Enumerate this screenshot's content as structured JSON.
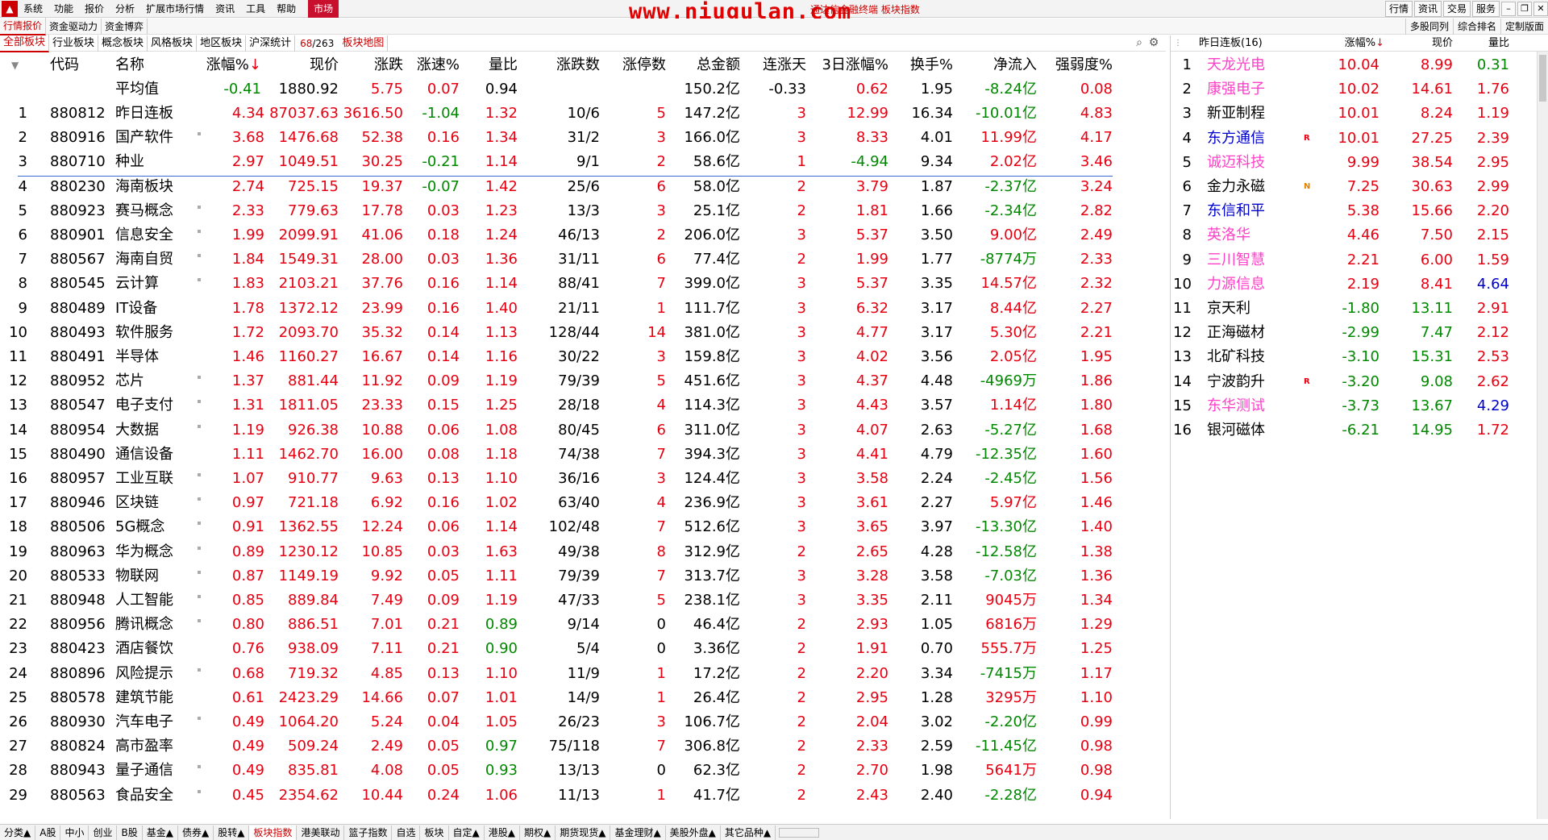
{
  "menubar": {
    "items": [
      "系统",
      "功能",
      "报价",
      "分析",
      "扩展市场行情",
      "资讯",
      "工具",
      "帮助"
    ],
    "active": "市场",
    "brand": "www.niugulan.com",
    "title": "通达信金融终端  板块指数",
    "right_buttons": [
      "行情",
      "资讯",
      "交易",
      "服务"
    ]
  },
  "tabbar1": {
    "tabs": [
      "行情报价",
      "资金驱动力",
      "资金博弈"
    ],
    "right_tabs": [
      "多股同列",
      "综合排名",
      "定制版面"
    ]
  },
  "tabbar2": {
    "tabs": [
      "全部板块",
      "行业板块",
      "概念板块",
      "风格板块",
      "地区板块",
      "沪深统计"
    ],
    "counter_current": "68",
    "counter_total": "/263",
    "map_tab": "板块地图"
  },
  "left_headers": {
    "code": "代码",
    "name": "名称",
    "pct": "涨幅%",
    "price": "现价",
    "chg": "涨跌",
    "speed": "涨速%",
    "vr": "量比",
    "updown": "涨跌数",
    "limitup": "涨停数",
    "amount": "总金额",
    "days": "连涨天",
    "d3": "3日涨幅%",
    "turnover": "换手%",
    "inflow": "净流入",
    "strength": "强弱度%"
  },
  "avg_row": {
    "name": "平均值",
    "pct": "-0.41",
    "price": "1880.92",
    "chg": "5.75",
    "speed": "0.07",
    "vr": "0.94",
    "amount": "150.2亿",
    "days": "-0.33",
    "d3": "0.62",
    "turnover": "1.95",
    "inflow": "-8.24亿",
    "strength": "0.08"
  },
  "rows": [
    {
      "no": "1",
      "code": "880812",
      "name": "昨日连板",
      "pct": "4.34",
      "price": "87037.63",
      "chg": "3616.50",
      "speed": "-1.04",
      "vr": "1.32",
      "updown": "10/6",
      "limitup": "5",
      "amount": "147.2亿",
      "days": "3",
      "d3": "12.99",
      "turnover": "16.34",
      "inflow": "-10.01亿",
      "strength": "4.83",
      "mark": false
    },
    {
      "no": "2",
      "code": "880916",
      "name": "国产软件",
      "pct": "3.68",
      "price": "1476.68",
      "chg": "52.38",
      "speed": "0.16",
      "vr": "1.34",
      "updown": "31/2",
      "limitup": "3",
      "amount": "166.0亿",
      "days": "3",
      "d3": "8.33",
      "turnover": "4.01",
      "inflow": "11.99亿",
      "strength": "4.17",
      "mark": true
    },
    {
      "no": "3",
      "code": "880710",
      "name": "种业",
      "pct": "2.97",
      "price": "1049.51",
      "chg": "30.25",
      "speed": "-0.21",
      "vr": "1.14",
      "updown": "9/1",
      "limitup": "2",
      "amount": "58.6亿",
      "days": "1",
      "d3": "-4.94",
      "turnover": "9.34",
      "inflow": "2.02亿",
      "strength": "3.46",
      "mark": false
    },
    {
      "no": "4",
      "code": "880230",
      "name": "海南板块",
      "pct": "2.74",
      "price": "725.15",
      "chg": "19.37",
      "speed": "-0.07",
      "vr": "1.42",
      "updown": "25/6",
      "limitup": "6",
      "amount": "58.0亿",
      "days": "2",
      "d3": "3.79",
      "turnover": "1.87",
      "inflow": "-2.37亿",
      "strength": "3.24",
      "mark": false
    },
    {
      "no": "5",
      "code": "880923",
      "name": "赛马概念",
      "pct": "2.33",
      "price": "779.63",
      "chg": "17.78",
      "speed": "0.03",
      "vr": "1.23",
      "updown": "13/3",
      "limitup": "3",
      "amount": "25.1亿",
      "days": "2",
      "d3": "1.81",
      "turnover": "1.66",
      "inflow": "-2.34亿",
      "strength": "2.82",
      "mark": true
    },
    {
      "no": "6",
      "code": "880901",
      "name": "信息安全",
      "pct": "1.99",
      "price": "2099.91",
      "chg": "41.06",
      "speed": "0.18",
      "vr": "1.24",
      "updown": "46/13",
      "limitup": "2",
      "amount": "206.0亿",
      "days": "3",
      "d3": "5.37",
      "turnover": "3.50",
      "inflow": "9.00亿",
      "strength": "2.49",
      "mark": true
    },
    {
      "no": "7",
      "code": "880567",
      "name": "海南自贸",
      "pct": "1.84",
      "price": "1549.31",
      "chg": "28.00",
      "speed": "0.03",
      "vr": "1.36",
      "updown": "31/11",
      "limitup": "6",
      "amount": "77.4亿",
      "days": "2",
      "d3": "1.99",
      "turnover": "1.77",
      "inflow": "-8774万",
      "strength": "2.33",
      "mark": true
    },
    {
      "no": "8",
      "code": "880545",
      "name": "云计算",
      "pct": "1.83",
      "price": "2103.21",
      "chg": "37.76",
      "speed": "0.16",
      "vr": "1.14",
      "updown": "88/41",
      "limitup": "7",
      "amount": "399.0亿",
      "days": "3",
      "d3": "5.37",
      "turnover": "3.35",
      "inflow": "14.57亿",
      "strength": "2.32",
      "mark": true
    },
    {
      "no": "9",
      "code": "880489",
      "name": "IT设备",
      "pct": "1.78",
      "price": "1372.12",
      "chg": "23.99",
      "speed": "0.16",
      "vr": "1.40",
      "updown": "21/11",
      "limitup": "1",
      "amount": "111.7亿",
      "days": "3",
      "d3": "6.32",
      "turnover": "3.17",
      "inflow": "8.44亿",
      "strength": "2.27",
      "mark": false
    },
    {
      "no": "10",
      "code": "880493",
      "name": "软件服务",
      "pct": "1.72",
      "price": "2093.70",
      "chg": "35.32",
      "speed": "0.14",
      "vr": "1.13",
      "updown": "128/44",
      "limitup": "14",
      "amount": "381.0亿",
      "days": "3",
      "d3": "4.77",
      "turnover": "3.17",
      "inflow": "5.30亿",
      "strength": "2.21",
      "mark": false
    },
    {
      "no": "11",
      "code": "880491",
      "name": "半导体",
      "pct": "1.46",
      "price": "1160.27",
      "chg": "16.67",
      "speed": "0.14",
      "vr": "1.16",
      "updown": "30/22",
      "limitup": "3",
      "amount": "159.8亿",
      "days": "3",
      "d3": "4.02",
      "turnover": "3.56",
      "inflow": "2.05亿",
      "strength": "1.95",
      "mark": false
    },
    {
      "no": "12",
      "code": "880952",
      "name": "芯片",
      "pct": "1.37",
      "price": "881.44",
      "chg": "11.92",
      "speed": "0.09",
      "vr": "1.19",
      "updown": "79/39",
      "limitup": "5",
      "amount": "451.6亿",
      "days": "3",
      "d3": "4.37",
      "turnover": "4.48",
      "inflow": "-4969万",
      "strength": "1.86",
      "mark": true
    },
    {
      "no": "13",
      "code": "880547",
      "name": "电子支付",
      "pct": "1.31",
      "price": "1811.05",
      "chg": "23.33",
      "speed": "0.15",
      "vr": "1.25",
      "updown": "28/18",
      "limitup": "4",
      "amount": "114.3亿",
      "days": "3",
      "d3": "4.43",
      "turnover": "3.57",
      "inflow": "1.14亿",
      "strength": "1.80",
      "mark": true
    },
    {
      "no": "14",
      "code": "880954",
      "name": "大数据",
      "pct": "1.19",
      "price": "926.38",
      "chg": "10.88",
      "speed": "0.06",
      "vr": "1.08",
      "updown": "80/45",
      "limitup": "6",
      "amount": "311.0亿",
      "days": "3",
      "d3": "4.07",
      "turnover": "2.63",
      "inflow": "-5.27亿",
      "strength": "1.68",
      "mark": true
    },
    {
      "no": "15",
      "code": "880490",
      "name": "通信设备",
      "pct": "1.11",
      "price": "1462.70",
      "chg": "16.00",
      "speed": "0.08",
      "vr": "1.18",
      "updown": "74/38",
      "limitup": "7",
      "amount": "394.3亿",
      "days": "3",
      "d3": "4.41",
      "turnover": "4.79",
      "inflow": "-12.35亿",
      "strength": "1.60",
      "mark": false
    },
    {
      "no": "16",
      "code": "880957",
      "name": "工业互联",
      "pct": "1.07",
      "price": "910.77",
      "chg": "9.63",
      "speed": "0.13",
      "vr": "1.10",
      "updown": "36/16",
      "limitup": "3",
      "amount": "124.4亿",
      "days": "3",
      "d3": "3.58",
      "turnover": "2.24",
      "inflow": "-2.45亿",
      "strength": "1.56",
      "mark": true
    },
    {
      "no": "17",
      "code": "880946",
      "name": "区块链",
      "pct": "0.97",
      "price": "721.18",
      "chg": "6.92",
      "speed": "0.16",
      "vr": "1.02",
      "updown": "63/40",
      "limitup": "4",
      "amount": "236.9亿",
      "days": "3",
      "d3": "3.61",
      "turnover": "2.27",
      "inflow": "5.97亿",
      "strength": "1.46",
      "mark": true
    },
    {
      "no": "18",
      "code": "880506",
      "name": "5G概念",
      "pct": "0.91",
      "price": "1362.55",
      "chg": "12.24",
      "speed": "0.06",
      "vr": "1.14",
      "updown": "102/48",
      "limitup": "7",
      "amount": "512.6亿",
      "days": "3",
      "d3": "3.65",
      "turnover": "3.97",
      "inflow": "-13.30亿",
      "strength": "1.40",
      "mark": true
    },
    {
      "no": "19",
      "code": "880963",
      "name": "华为概念",
      "pct": "0.89",
      "price": "1230.12",
      "chg": "10.85",
      "speed": "0.03",
      "vr": "1.63",
      "updown": "49/38",
      "limitup": "8",
      "amount": "312.9亿",
      "days": "2",
      "d3": "2.65",
      "turnover": "4.28",
      "inflow": "-12.58亿",
      "strength": "1.38",
      "mark": true
    },
    {
      "no": "20",
      "code": "880533",
      "name": "物联网",
      "pct": "0.87",
      "price": "1149.19",
      "chg": "9.92",
      "speed": "0.05",
      "vr": "1.11",
      "updown": "79/39",
      "limitup": "7",
      "amount": "313.7亿",
      "days": "3",
      "d3": "3.28",
      "turnover": "3.58",
      "inflow": "-7.03亿",
      "strength": "1.36",
      "mark": true
    },
    {
      "no": "21",
      "code": "880948",
      "name": "人工智能",
      "pct": "0.85",
      "price": "889.84",
      "chg": "7.49",
      "speed": "0.09",
      "vr": "1.19",
      "updown": "47/33",
      "limitup": "5",
      "amount": "238.1亿",
      "days": "3",
      "d3": "3.35",
      "turnover": "2.11",
      "inflow": "9045万",
      "strength": "1.34",
      "mark": true
    },
    {
      "no": "22",
      "code": "880956",
      "name": "腾讯概念",
      "pct": "0.80",
      "price": "886.51",
      "chg": "7.01",
      "speed": "0.21",
      "vr": "0.89",
      "updown": "9/14",
      "limitup": "0",
      "amount": "46.4亿",
      "days": "2",
      "d3": "2.93",
      "turnover": "1.05",
      "inflow": "6816万",
      "strength": "1.29",
      "mark": true
    },
    {
      "no": "23",
      "code": "880423",
      "name": "酒店餐饮",
      "pct": "0.76",
      "price": "938.09",
      "chg": "7.11",
      "speed": "0.21",
      "vr": "0.90",
      "updown": "5/4",
      "limitup": "0",
      "amount": "3.36亿",
      "days": "2",
      "d3": "1.91",
      "turnover": "0.70",
      "inflow": "555.7万",
      "strength": "1.25",
      "mark": false
    },
    {
      "no": "24",
      "code": "880896",
      "name": "风险提示",
      "pct": "0.68",
      "price": "719.32",
      "chg": "4.85",
      "speed": "0.13",
      "vr": "1.10",
      "updown": "11/9",
      "limitup": "1",
      "amount": "17.2亿",
      "days": "2",
      "d3": "2.20",
      "turnover": "3.34",
      "inflow": "-7415万",
      "strength": "1.17",
      "mark": true
    },
    {
      "no": "25",
      "code": "880578",
      "name": "建筑节能",
      "pct": "0.61",
      "price": "2423.29",
      "chg": "14.66",
      "speed": "0.07",
      "vr": "1.01",
      "updown": "14/9",
      "limitup": "1",
      "amount": "26.4亿",
      "days": "2",
      "d3": "2.95",
      "turnover": "1.28",
      "inflow": "3295万",
      "strength": "1.10",
      "mark": false
    },
    {
      "no": "26",
      "code": "880930",
      "name": "汽车电子",
      "pct": "0.49",
      "price": "1064.20",
      "chg": "5.24",
      "speed": "0.04",
      "vr": "1.05",
      "updown": "26/23",
      "limitup": "3",
      "amount": "106.7亿",
      "days": "2",
      "d3": "2.04",
      "turnover": "3.02",
      "inflow": "-2.20亿",
      "strength": "0.99",
      "mark": true
    },
    {
      "no": "27",
      "code": "880824",
      "name": "高市盈率",
      "pct": "0.49",
      "price": "509.24",
      "chg": "2.49",
      "speed": "0.05",
      "vr": "0.97",
      "updown": "75/118",
      "limitup": "7",
      "amount": "306.8亿",
      "days": "2",
      "d3": "2.33",
      "turnover": "2.59",
      "inflow": "-11.45亿",
      "strength": "0.98",
      "mark": false
    },
    {
      "no": "28",
      "code": "880943",
      "name": "量子通信",
      "pct": "0.49",
      "price": "835.81",
      "chg": "4.08",
      "speed": "0.05",
      "vr": "0.93",
      "updown": "13/13",
      "limitup": "0",
      "amount": "62.3亿",
      "days": "2",
      "d3": "2.70",
      "turnover": "1.98",
      "inflow": "5641万",
      "strength": "0.98",
      "mark": true
    },
    {
      "no": "29",
      "code": "880563",
      "name": "食品安全",
      "pct": "0.45",
      "price": "2354.62",
      "chg": "10.44",
      "speed": "0.24",
      "vr": "1.06",
      "updown": "11/13",
      "limitup": "1",
      "amount": "41.7亿",
      "days": "2",
      "d3": "2.43",
      "turnover": "2.40",
      "inflow": "-2.28亿",
      "strength": "0.94",
      "mark": true
    }
  ],
  "right_panel": {
    "title": "昨日连板(16)",
    "headers": {
      "pct": "涨幅%",
      "price": "现价",
      "vr": "量比"
    },
    "rows": [
      {
        "no": "1",
        "name": "天龙光电",
        "tag": "",
        "pct": "10.04",
        "price": "8.99",
        "vr": "0.31",
        "name_color": "pink",
        "vr_color": "green"
      },
      {
        "no": "2",
        "name": "康强电子",
        "tag": "",
        "pct": "10.02",
        "price": "14.61",
        "vr": "1.76",
        "name_color": "pink",
        "vr_color": "red"
      },
      {
        "no": "3",
        "name": "新亚制程",
        "tag": "",
        "pct": "10.01",
        "price": "8.24",
        "vr": "1.19",
        "name_color": "blk",
        "vr_color": "red"
      },
      {
        "no": "4",
        "name": "东方通信",
        "tag": "R",
        "pct": "10.01",
        "price": "27.25",
        "vr": "2.39",
        "name_color": "blue",
        "vr_color": "red"
      },
      {
        "no": "5",
        "name": "诚迈科技",
        "tag": "",
        "pct": "9.99",
        "price": "38.54",
        "vr": "2.95",
        "name_color": "pink",
        "vr_color": "red"
      },
      {
        "no": "6",
        "name": "金力永磁",
        "tag": "N",
        "pct": "7.25",
        "price": "30.63",
        "vr": "2.99",
        "name_color": "blk",
        "vr_color": "red"
      },
      {
        "no": "7",
        "name": "东信和平",
        "tag": "",
        "pct": "5.38",
        "price": "15.66",
        "vr": "2.20",
        "name_color": "blue",
        "vr_color": "red"
      },
      {
        "no": "8",
        "name": "英洛华",
        "tag": "",
        "pct": "4.46",
        "price": "7.50",
        "vr": "2.15",
        "name_color": "pink",
        "vr_color": "red"
      },
      {
        "no": "9",
        "name": "三川智慧",
        "tag": "",
        "pct": "2.21",
        "price": "6.00",
        "vr": "1.59",
        "name_color": "pink",
        "vr_color": "red"
      },
      {
        "no": "10",
        "name": "力源信息",
        "tag": "",
        "pct": "2.19",
        "price": "8.41",
        "vr": "4.64",
        "name_color": "pink",
        "vr_color": "blue"
      },
      {
        "no": "11",
        "name": "京天利",
        "tag": "",
        "pct": "-1.80",
        "price": "13.11",
        "vr": "2.91",
        "name_color": "blk",
        "vr_color": "red"
      },
      {
        "no": "12",
        "name": "正海磁材",
        "tag": "",
        "pct": "-2.99",
        "price": "7.47",
        "vr": "2.12",
        "name_color": "blk",
        "vr_color": "red"
      },
      {
        "no": "13",
        "name": "北矿科技",
        "tag": "",
        "pct": "-3.10",
        "price": "15.31",
        "vr": "2.53",
        "name_color": "blk",
        "vr_color": "red"
      },
      {
        "no": "14",
        "name": "宁波韵升",
        "tag": "R",
        "pct": "-3.20",
        "price": "9.08",
        "vr": "2.62",
        "name_color": "blk",
        "vr_color": "red"
      },
      {
        "no": "15",
        "name": "东华测试",
        "tag": "",
        "pct": "-3.73",
        "price": "13.67",
        "vr": "4.29",
        "name_color": "pink",
        "vr_color": "blue"
      },
      {
        "no": "16",
        "name": "银河磁体",
        "tag": "",
        "pct": "-6.21",
        "price": "14.95",
        "vr": "1.72",
        "name_color": "blk",
        "vr_color": "red"
      }
    ]
  },
  "bottom_tabs": [
    "分类▲",
    "A股",
    "中小",
    "创业",
    "B股",
    "基金▲",
    "债券▲",
    "股转▲",
    "板块指数",
    "港美联动",
    "篮子指数",
    "自选",
    "板块",
    "自定▲",
    "港股▲",
    "期权▲",
    "期货现货▲",
    "基金理财▲",
    "美股外盘▲",
    "其它品种▲"
  ],
  "bottom_active": "板块指数",
  "colors": {
    "up": "#e60012",
    "down": "#008800",
    "accent": "#c8102e"
  }
}
